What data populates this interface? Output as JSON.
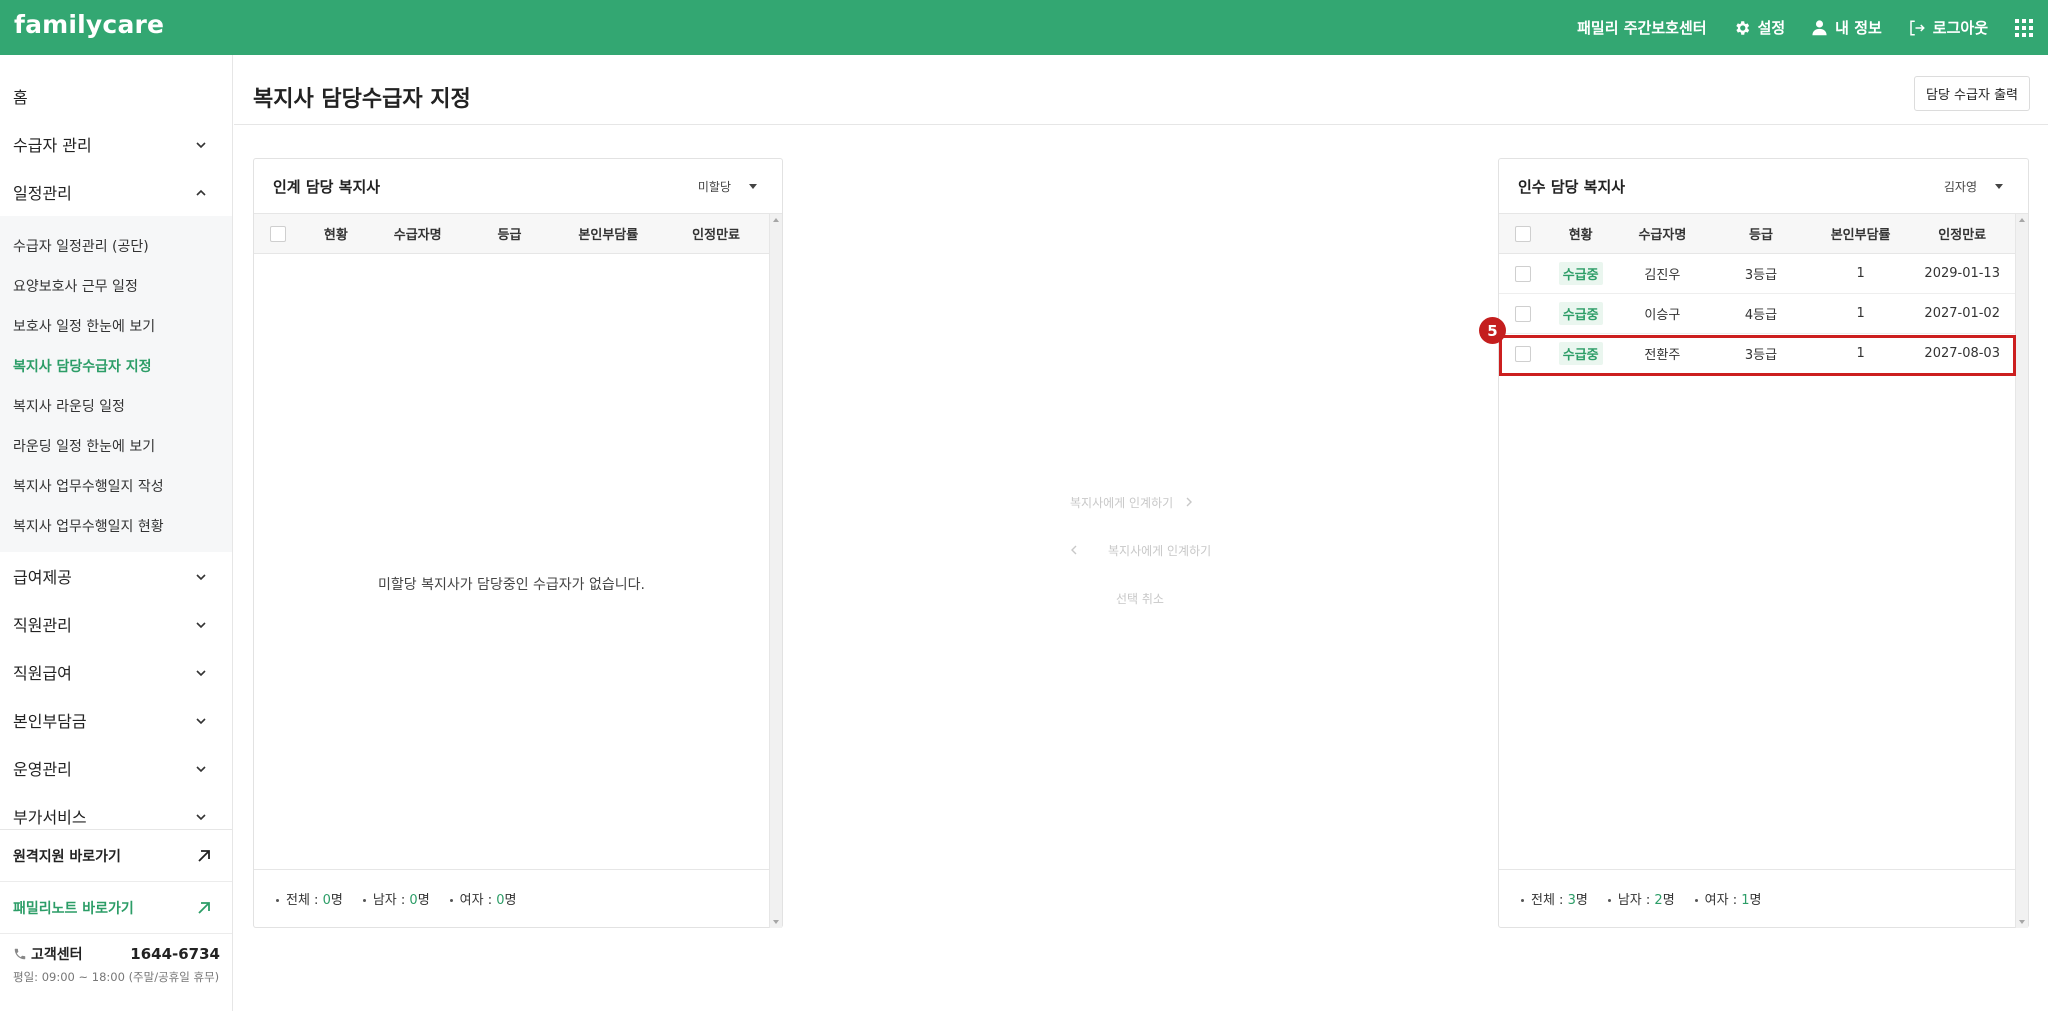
{
  "app": {
    "logo": "familycare",
    "center_name": "패밀리 주간보호센터",
    "settings_label": "설정",
    "profile_label": "내 정보",
    "logout_label": "로그아웃"
  },
  "sidebar": {
    "items": [
      {
        "label": "홈"
      },
      {
        "label": "수급자 관리"
      },
      {
        "label": "일정관리"
      }
    ],
    "schedule_sub": [
      {
        "label": "수급자 일정관리 (공단)"
      },
      {
        "label": "요양보호사 근무 일정"
      },
      {
        "label": "보호사 일정 한눈에 보기"
      },
      {
        "label": "복지사 담당수급자 지정"
      },
      {
        "label": "복지사 라운딩 일정"
      },
      {
        "label": "라운딩 일정 한눈에 보기"
      },
      {
        "label": "복지사 업무수행일지 작성"
      },
      {
        "label": "복지사 업무수행일지 현황"
      }
    ],
    "items_after": [
      {
        "label": "급여제공"
      },
      {
        "label": "직원관리"
      },
      {
        "label": "직원급여"
      },
      {
        "label": "본인부담금"
      },
      {
        "label": "운영관리"
      },
      {
        "label": "부가서비스"
      }
    ],
    "remote_support": "원격지원 바로가기",
    "familynote": "패밀리노트 바로가기",
    "cs_label": "고객센터",
    "cs_phone": "1644-6734",
    "cs_hours": "평일: 09:00 ~ 18:00 (주말/공휴일 휴무)"
  },
  "page": {
    "title": "복지사 담당수급자 지정",
    "print_button": "담당 수급자 출력"
  },
  "left_panel": {
    "title": "인계 담당 복지사",
    "select_value": "미할당",
    "columns": [
      "현황",
      "수급자명",
      "등급",
      "본인부담률",
      "인정만료"
    ],
    "empty_message": "미할당 복지사가 담당중인 수급자가 없습니다.",
    "footer": {
      "total_label": "전체 : ",
      "total_value": "0",
      "total_unit": "명",
      "male_label": "남자 : ",
      "male_value": "0",
      "male_unit": "명",
      "female_label": "여자 : ",
      "female_value": "0",
      "female_unit": "명"
    }
  },
  "middle": {
    "transfer_right": "복지사에게 인계하기",
    "transfer_left": "복지사에게 인계하기",
    "cancel_selection": "선택 취소"
  },
  "right_panel": {
    "title": "인수 담당 복지사",
    "select_value": "김자영",
    "columns": [
      "현황",
      "수급자명",
      "등급",
      "본인부담률",
      "인정만료"
    ],
    "rows": [
      {
        "status": "수급중",
        "name": "김진우",
        "grade": "3등급",
        "copay": "1",
        "expiry": "2029-01-13"
      },
      {
        "status": "수급중",
        "name": "이승구",
        "grade": "4등급",
        "copay": "1",
        "expiry": "2027-01-02"
      },
      {
        "status": "수급중",
        "name": "전환주",
        "grade": "3등급",
        "copay": "1",
        "expiry": "2027-08-03"
      }
    ],
    "footer": {
      "total_label": "전체 : ",
      "total_value": "3",
      "total_unit": "명",
      "male_label": "남자 : ",
      "male_value": "2",
      "male_unit": "명",
      "female_label": "여자 : ",
      "female_value": "1",
      "female_unit": "명"
    }
  },
  "annotation": {
    "step_number": "5"
  },
  "colors": {
    "brand": "#33a772",
    "accent_text": "#2c9d67",
    "highlight": "#cc1f1f"
  }
}
